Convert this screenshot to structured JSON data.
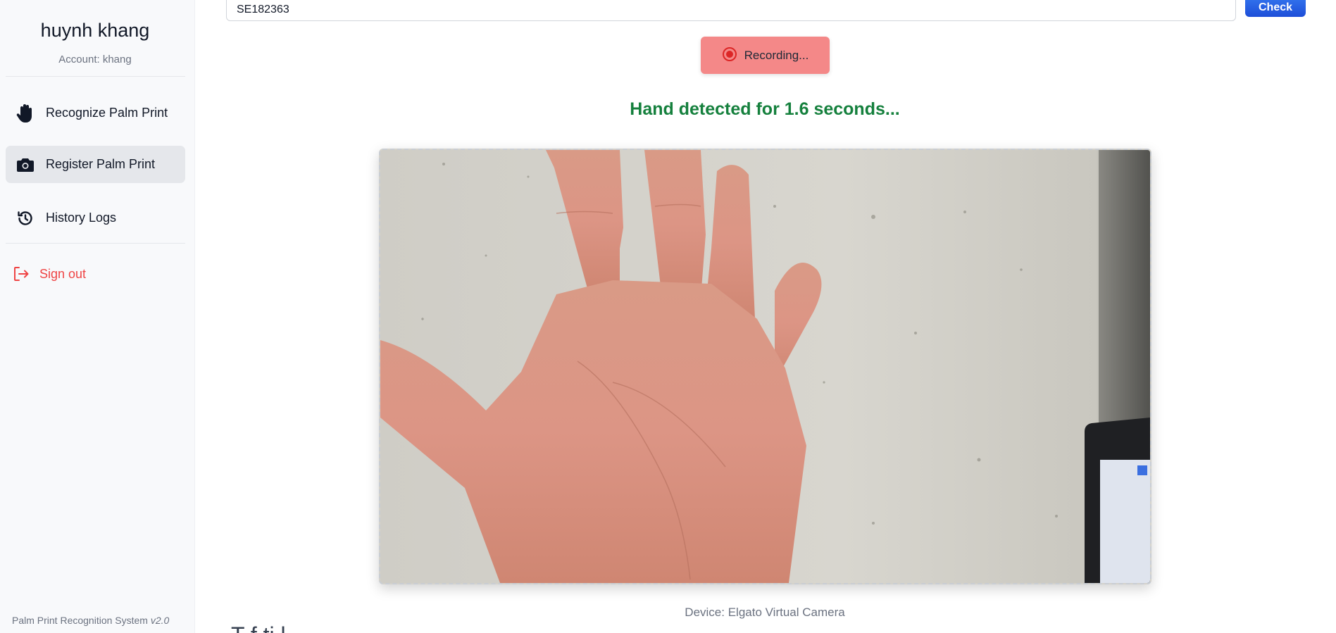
{
  "sidebar": {
    "user_name": "huynh khang",
    "account": "Account: khang",
    "nav": [
      {
        "label": "Recognize Palm Print",
        "icon": "hand-icon",
        "active": false
      },
      {
        "label": "Register Palm Print",
        "icon": "camera-icon",
        "active": true
      },
      {
        "label": "History Logs",
        "icon": "history-icon",
        "active": false
      }
    ],
    "signout_label": "Sign out",
    "footer_text": "Palm Print Recognition System ",
    "footer_version": "v2.0"
  },
  "main": {
    "id_value": "SE182363",
    "check_label": "Check",
    "record_label": "Recording...",
    "status_text": "Hand detected for 1.6 seconds...",
    "device_label": "Device: Elgato Virtual Camera",
    "cutoff_heading": "T f  ti l"
  },
  "colors": {
    "accent": "#2563eb",
    "record": "#f48888",
    "status": "#15803d",
    "signout": "#ef4444"
  }
}
